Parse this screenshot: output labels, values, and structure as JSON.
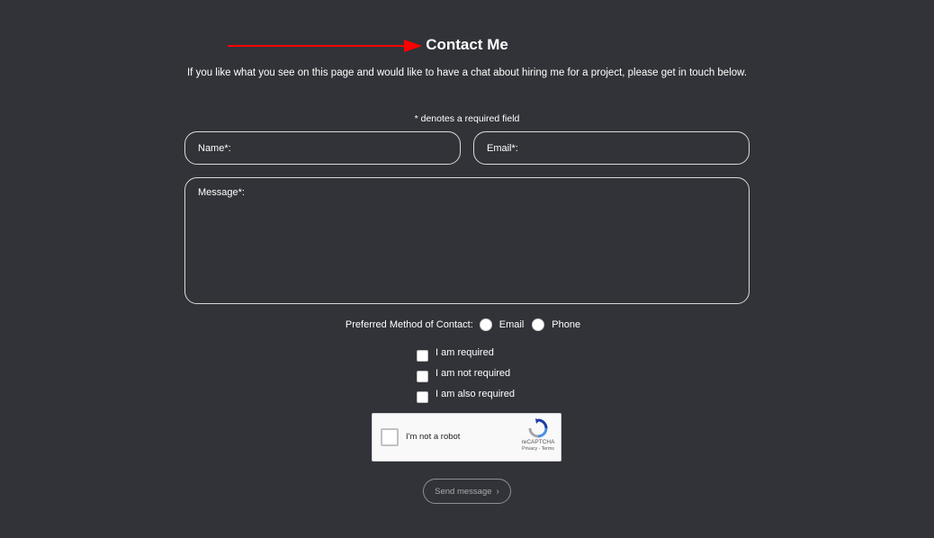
{
  "header": {
    "title": "Contact Me",
    "intro": "If you like what you see on this page and would like to have a chat about hiring me for a project, please get in touch below."
  },
  "form": {
    "required_note": "* denotes a required field",
    "name_placeholder": "Name*:",
    "email_placeholder": "Email*:",
    "message_placeholder": "Message*:",
    "contact_method": {
      "label": "Preferred Method of Contact:",
      "options": [
        "Email",
        "Phone"
      ]
    },
    "checkboxes": [
      "I am required",
      "I am not required",
      "I am also required"
    ],
    "send_label": "Send message"
  },
  "recaptcha": {
    "label": "I'm not a robot",
    "brand": "reCAPTCHA",
    "links": "Privacy - Terms"
  },
  "colors": {
    "background": "#313338",
    "arrow": "#ff0000",
    "text": "#ffffff",
    "field_border": "#d9d9d9"
  },
  "icons": {
    "annotation_arrow": "right-arrow",
    "send_chevron": "chevron-right-icon",
    "recaptcha_logo": "recaptcha-icon"
  }
}
